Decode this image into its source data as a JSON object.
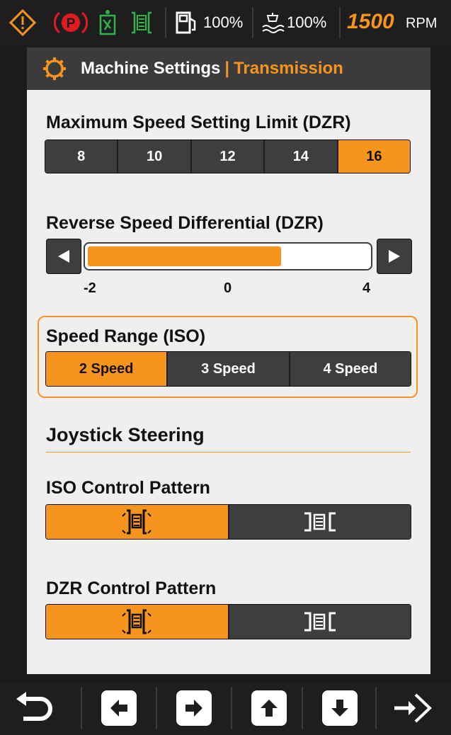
{
  "status_bar": {
    "icons": [
      "warning-icon",
      "parking-brake-icon",
      "seatbelt-icon",
      "transmission-icon",
      "fuel-icon",
      "def-icon"
    ],
    "fuel_level": "100%",
    "def_level": "100%",
    "rpm_value": "1500",
    "rpm_unit": "RPM"
  },
  "header": {
    "icon": "gear-icon",
    "title": "Machine Settings",
    "separator": "|",
    "subtitle": "Transmission"
  },
  "max_speed": {
    "label": "Maximum Speed Setting Limit (DZR)",
    "options": [
      "8",
      "10",
      "12",
      "14",
      "16"
    ],
    "selected": "16"
  },
  "reverse_speed": {
    "label": "Reverse Speed Differential (DZR)",
    "min_label": "-2",
    "mid_label": "0",
    "max_label": "4",
    "value_fraction": 0.69
  },
  "speed_range": {
    "label": "Speed Range (ISO)",
    "options": [
      "2 Speed",
      "3 Speed",
      "4 Speed"
    ],
    "selected": "2 Speed"
  },
  "joystick": {
    "heading": "Joystick Steering",
    "iso_label": "ISO Control Pattern",
    "dzr_label": "DZR Control Pattern",
    "iso_selected": "machine-forward-pattern-icon",
    "dzr_selected": "machine-forward-pattern-icon"
  },
  "bottom_bar": {
    "buttons": [
      "back-icon",
      "arrow-left-icon",
      "arrow-right-icon",
      "arrow-up-icon",
      "arrow-down-icon",
      "enter-icon"
    ]
  },
  "colors": {
    "accent": "#f7941d",
    "dark_button": "#3e3e3e",
    "panel_bg": "#efefef",
    "parking_red": "#e21b23",
    "seatbelt_green": "#2db34a"
  }
}
